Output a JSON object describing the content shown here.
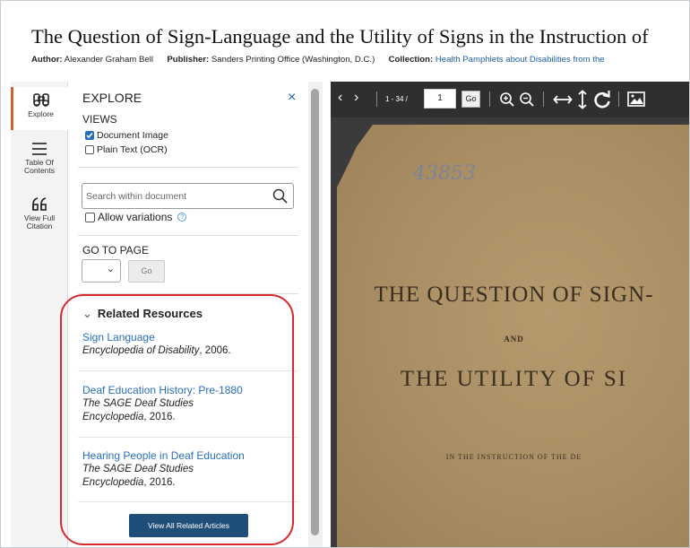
{
  "document": {
    "title": "The Question of Sign-Language and the Utility of Signs in the Instruction of",
    "author_label": "Author:",
    "author": "Alexander Graham Bell",
    "publisher_label": "Publisher:",
    "publisher": "Sanders Printing Office (Washington, D.C.)",
    "collection_label": "Collection:",
    "collection": "Health Pamphlets about Disabilities from the"
  },
  "rail": {
    "explore": "Explore",
    "toc_line1": "Table Of",
    "toc_line2": "Contents",
    "citation_line1": "View Full",
    "citation_line2": "Citation"
  },
  "explore": {
    "title": "EXPLORE",
    "close": "×",
    "views_label": "VIEWS",
    "views": [
      {
        "label": "Document Image",
        "checked": true
      },
      {
        "label": "Plain Text (OCR)",
        "checked": false
      }
    ],
    "search_placeholder": "Search within document",
    "allow_variations": "Allow variations",
    "help": "?",
    "goto_label": "GO TO PAGE",
    "go": "Go"
  },
  "related": {
    "header": "Related Resources",
    "items": [
      {
        "title": "Sign Language",
        "source": "Encyclopedia of Disability",
        "year": ", 2006."
      },
      {
        "title": "Deaf Education History: Pre-1880",
        "source": "The SAGE Deaf Studies Encyclopedia",
        "year": ", 2016."
      },
      {
        "title": "Hearing People in Deaf Education",
        "source": "The SAGE Deaf Studies Encyclopedia",
        "year": ", 2016."
      }
    ],
    "view_all": "View All Related Articles"
  },
  "viewer": {
    "page_range": "1 - 34 /",
    "page_value": "1",
    "go": "Go"
  },
  "scan": {
    "stamp": "43853",
    "line1": "THE QUESTION OF SIGN-",
    "line2": "AND",
    "line3": "THE UTILITY OF SI",
    "line4": "IN THE INSTRUCTION OF THE DE"
  }
}
